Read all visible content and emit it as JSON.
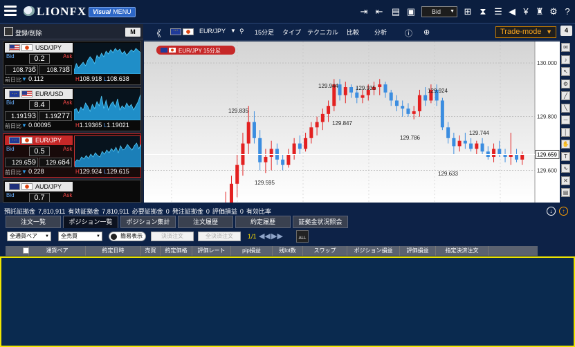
{
  "header": {
    "logo": "LIONFX",
    "visual_menu": {
      "prefix": "Visual",
      "label": "MENU"
    },
    "price_type": "Bid",
    "icons": [
      "export-icon",
      "import-icon",
      "print-icon",
      "save-icon",
      "layout-icon",
      "hourglass-icon",
      "list-icon",
      "announce-icon",
      "money-icon",
      "paint-icon",
      "gear-icon",
      "help-icon"
    ]
  },
  "sidebar": {
    "register_label": "登録/削除",
    "m_button": "M",
    "pairs": [
      {
        "name": "USD/JPY",
        "base": "us",
        "quote": "jp",
        "bid_label": "Bid",
        "ask_label": "Ask",
        "spread": "0.2",
        "bid": "108.736",
        "ask": "108.738",
        "bid_main": "108.73",
        "bid_last": "6",
        "ask_main": "108.73",
        "ask_last": "8",
        "change_label": "前日比",
        "change_arrow": "▼",
        "change": "0.112",
        "high_label": "H",
        "high": "108.918",
        "low_label": "L",
        "low": "108.638",
        "selected": false,
        "spark": [
          40,
          30,
          36,
          32,
          28,
          33,
          25,
          20,
          24,
          30,
          18,
          22,
          15,
          20,
          12,
          16,
          10,
          14,
          8,
          12,
          9,
          16,
          12,
          18,
          14,
          10,
          13,
          8,
          11,
          14
        ]
      },
      {
        "name": "EUR/USD",
        "base": "eu",
        "quote": "us",
        "bid_label": "Bid",
        "ask_label": "Ask",
        "spread": "8.4",
        "bid": "1.19193",
        "ask": "1.19277",
        "bid_main": "1.19",
        "bid_last": "193",
        "ask_main": "1.19",
        "ask_last": "277",
        "change_label": "前日比",
        "change_arrow": "▼",
        "change": "0.00095",
        "high_label": "H",
        "high": "1.19365",
        "low_label": "L",
        "low": "1.19021",
        "selected": false,
        "spark": [
          30,
          28,
          34,
          26,
          30,
          20,
          25,
          32,
          22,
          28,
          18,
          24,
          10,
          28,
          16,
          30,
          22,
          18,
          26,
          14,
          30,
          24,
          28,
          20,
          26,
          22,
          30,
          24,
          18,
          8
        ]
      },
      {
        "name": "EUR/JPY",
        "base": "eu",
        "quote": "jp",
        "bid_label": "Bid",
        "ask_label": "Ask",
        "spread": "0.5",
        "bid": "129.659",
        "ask": "129.664",
        "bid_main": "129.6",
        "bid_last": "59",
        "ask_main": "129.6",
        "ask_last": "64",
        "change_label": "前日比",
        "change_arrow": "▼",
        "change": "0.228",
        "high_label": "H",
        "high": "129.924",
        "low_label": "L",
        "low": "129.615",
        "selected": true,
        "spark": [
          38,
          34,
          36,
          30,
          33,
          28,
          32,
          26,
          30,
          24,
          28,
          30,
          22,
          26,
          20,
          24,
          18,
          22,
          16,
          24,
          14,
          20,
          18,
          12,
          16,
          20,
          14,
          10,
          18,
          12
        ]
      },
      {
        "name": "AUD/JPY",
        "base": "au",
        "quote": "jp",
        "bid_label": "Bid",
        "ask_label": "Ask",
        "spread": "0.7",
        "bid": "",
        "ask": "",
        "bid_main": "",
        "bid_last": "",
        "ask_main": "",
        "ask_last": "",
        "change_label": "",
        "change_arrow": "",
        "change": "",
        "high_label": "",
        "high": "",
        "low_label": "",
        "low": "",
        "selected": false,
        "spark": []
      }
    ]
  },
  "chart_toolbar": {
    "pair": "EUR/JPY",
    "timeframe": "15分足",
    "type_label": "タイプ",
    "technical_label": "テクニカル",
    "compare_label": "比較",
    "analysis_label": "分析",
    "trade_mode": "Trade-mode",
    "tab_count": "4"
  },
  "chart_data": {
    "type": "candlestick",
    "title": "EUR/JPY 15分足",
    "y_ticks": [
      "130.000",
      "129.800",
      "129.600"
    ],
    "current_price": "129.659",
    "annotations": [
      "129.944",
      "129.935",
      "129.924",
      "129.835",
      "129.847",
      "129.786",
      "129.744",
      "129.595",
      "129.633"
    ],
    "candles": [
      [
        129.39,
        129.47,
        129.36,
        129.44
      ],
      [
        129.44,
        129.52,
        129.4,
        129.47
      ],
      [
        129.47,
        129.58,
        129.44,
        129.55
      ],
      [
        129.55,
        129.66,
        129.5,
        129.62
      ],
      [
        129.62,
        129.74,
        129.58,
        129.7
      ],
      [
        129.7,
        129.84,
        129.66,
        129.78
      ],
      [
        129.78,
        129.82,
        129.7,
        129.72
      ],
      [
        129.72,
        129.75,
        129.6,
        129.63
      ],
      [
        129.63,
        129.68,
        129.59,
        129.65
      ],
      [
        129.65,
        129.71,
        129.6,
        129.68
      ],
      [
        129.68,
        129.7,
        129.62,
        129.64
      ],
      [
        129.64,
        129.66,
        129.6,
        129.62
      ],
      [
        129.62,
        129.68,
        129.61,
        129.66
      ],
      [
        129.66,
        129.72,
        129.64,
        129.7
      ],
      [
        129.7,
        129.73,
        129.66,
        129.68
      ],
      [
        129.68,
        129.74,
        129.67,
        129.72
      ],
      [
        129.72,
        129.78,
        129.7,
        129.76
      ],
      [
        129.76,
        129.8,
        129.73,
        129.78
      ],
      [
        129.78,
        129.83,
        129.75,
        129.81
      ],
      [
        129.81,
        129.86,
        129.78,
        129.84
      ],
      [
        129.84,
        129.94,
        129.82,
        129.92
      ],
      [
        129.92,
        129.94,
        129.86,
        129.88
      ],
      [
        129.88,
        129.93,
        129.85,
        129.91
      ],
      [
        129.91,
        129.92,
        129.87,
        129.89
      ],
      [
        129.89,
        129.91,
        129.85,
        129.87
      ],
      [
        129.87,
        129.9,
        129.85,
        129.88
      ],
      [
        129.88,
        129.92,
        129.86,
        129.9
      ],
      [
        129.9,
        129.93,
        129.88,
        129.91
      ],
      [
        129.91,
        129.94,
        129.88,
        129.92
      ],
      [
        129.92,
        129.93,
        129.87,
        129.89
      ],
      [
        129.89,
        129.9,
        129.84,
        129.86
      ],
      [
        129.86,
        129.88,
        129.82,
        129.84
      ],
      [
        129.84,
        129.86,
        129.8,
        129.83
      ],
      [
        129.83,
        129.85,
        129.8,
        129.81
      ],
      [
        129.81,
        129.84,
        129.79,
        129.82
      ],
      [
        129.82,
        129.9,
        129.8,
        129.88
      ],
      [
        129.88,
        129.91,
        129.84,
        129.86
      ],
      [
        129.86,
        129.92,
        129.85,
        129.9
      ],
      [
        129.9,
        129.92,
        129.84,
        129.86
      ],
      [
        129.86,
        129.87,
        129.75,
        129.76
      ],
      [
        129.76,
        129.78,
        129.7,
        129.72
      ],
      [
        129.72,
        129.74,
        129.66,
        129.69
      ],
      [
        129.69,
        129.73,
        129.67,
        129.71
      ],
      [
        129.71,
        129.74,
        129.68,
        129.7
      ],
      [
        129.7,
        129.72,
        129.67,
        129.68
      ],
      [
        129.68,
        129.71,
        129.66,
        129.7
      ],
      [
        129.7,
        129.72,
        129.66,
        129.67
      ],
      [
        129.67,
        129.69,
        129.64,
        129.65
      ],
      [
        129.65,
        129.7,
        129.63,
        129.68
      ],
      [
        129.68,
        129.71,
        129.65,
        129.66
      ],
      [
        129.66,
        129.68,
        129.63,
        129.65
      ],
      [
        129.65,
        129.74,
        129.62,
        129.66
      ],
      [
        129.66,
        129.68,
        129.63,
        129.64
      ],
      [
        129.64,
        129.67,
        129.62,
        129.659
      ]
    ]
  },
  "account": {
    "items": [
      {
        "label": "預託証拠金",
        "value": "7,810,911"
      },
      {
        "label": "有効証拠金",
        "value": "7,810,911"
      },
      {
        "label": "必要証拠金",
        "value": "0"
      },
      {
        "label": "発注証拠金",
        "value": "0"
      },
      {
        "label": "評価損益",
        "value": "0"
      },
      {
        "label": "有効比率",
        "value": ""
      }
    ]
  },
  "tabs": [
    "注文一覧",
    "ポジション一覧",
    "ポジション集計",
    "注文履歴",
    "約定履歴",
    "証拠金状況照会"
  ],
  "active_tab": "ポジション一覧",
  "filters": {
    "pair": "全通貨ペア",
    "side": "全売買",
    "simple_display": "簡易表示",
    "settle_order": "決済注文",
    "settle_all": "全決済注文",
    "page": "1/1",
    "all_label": "ALL"
  },
  "table": {
    "columns": [
      "通貨ペア",
      "約定日時",
      "売買",
      "約定価格",
      "評価レート",
      "pip損益",
      "残lot数",
      "スワップ",
      "ポジション損益",
      "評価損益",
      "指定決済注文"
    ],
    "rows": []
  }
}
